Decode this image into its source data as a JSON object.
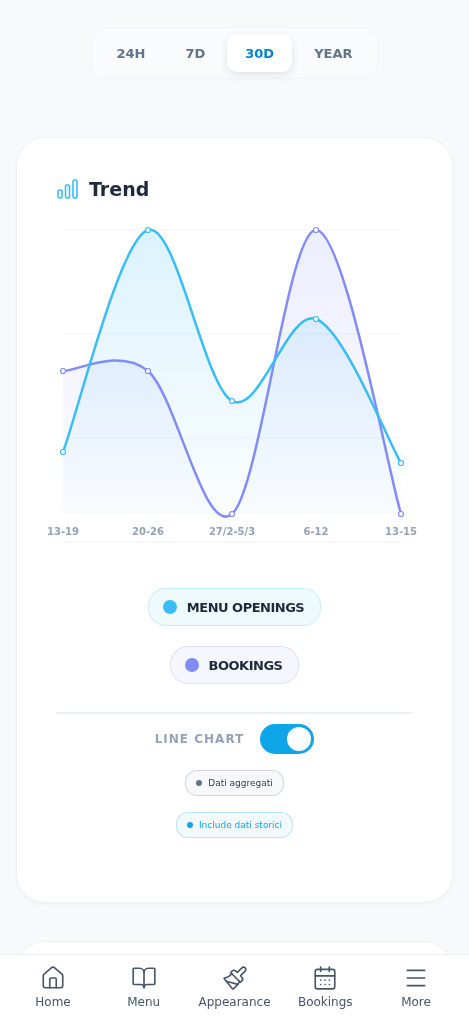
{
  "period_tabs": [
    {
      "label": "24H",
      "selected": false
    },
    {
      "label": "7D",
      "selected": false
    },
    {
      "label": "30D",
      "selected": true
    },
    {
      "label": "YEAR",
      "selected": false
    }
  ],
  "trend_card": {
    "title": "Trend",
    "chart": {
      "x_labels": [
        "13-19",
        "20-26",
        "27/2-5/3",
        "6-12",
        "13-15"
      ]
    },
    "legend": [
      {
        "label": "MENU OPENINGS",
        "color": "#38bdf8"
      },
      {
        "label": "BOOKINGS",
        "color": "#818cf8"
      }
    ],
    "line_chart_toggle": {
      "label": "LINE CHART",
      "on": true
    },
    "chips": [
      {
        "label": "Dati aggregati",
        "color": "#64748b"
      },
      {
        "label": "Include dati storici",
        "color": "#0ea5e9"
      }
    ]
  },
  "bottom_nav": [
    {
      "label": "Home"
    },
    {
      "label": "Menu"
    },
    {
      "label": "Appearance"
    },
    {
      "label": "Bookings"
    },
    {
      "label": "More"
    }
  ]
}
